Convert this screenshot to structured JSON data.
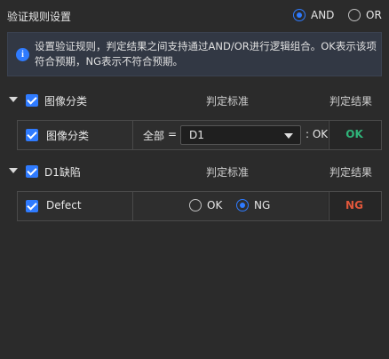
{
  "header": {
    "title": "验证规则设置",
    "logic_options": [
      {
        "label": "AND",
        "selected": true
      },
      {
        "label": "OR",
        "selected": false
      }
    ]
  },
  "info": {
    "icon": "info-icon",
    "text": "设置验证规则，判定结果之间支持通过AND/OR进行逻辑组合。OK表示该项符合预期，NG表示不符合预期。"
  },
  "groups": [
    {
      "name": "图像分类",
      "checked": true,
      "criteria_header": "判定标准",
      "result_header": "判定结果",
      "row": {
        "label": "图像分类",
        "checked": true,
        "scope": "全部",
        "operator": "=",
        "select_value": "D1",
        "suffix": ": OK",
        "result": "OK"
      }
    },
    {
      "name": "D1缺陷",
      "checked": true,
      "criteria_header": "判定标准",
      "result_header": "判定结果",
      "row": {
        "label": "Defect",
        "checked": true,
        "options": [
          {
            "label": "OK",
            "selected": false
          },
          {
            "label": "NG",
            "selected": true
          }
        ],
        "result": "NG"
      }
    }
  ],
  "colors": {
    "accent": "#2f7bff",
    "ok": "#2fb57a",
    "ng": "#e0573b",
    "background": "#2b2b2b"
  }
}
